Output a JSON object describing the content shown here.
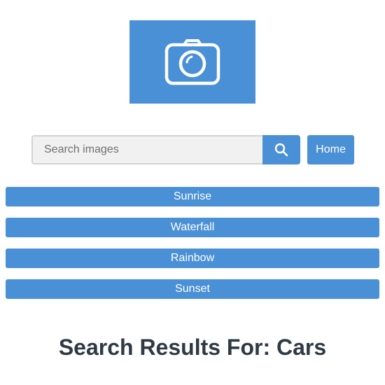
{
  "logo": {
    "icon": "camera-icon",
    "background": "#4a90d6"
  },
  "search": {
    "placeholder": "Search images",
    "value": "",
    "button_icon": "search-icon"
  },
  "nav": {
    "home_label": "Home"
  },
  "suggestions": [
    {
      "label": "Sunrise"
    },
    {
      "label": "Waterfall"
    },
    {
      "label": "Rainbow"
    },
    {
      "label": "Sunset"
    }
  ],
  "results": {
    "title": "Search Results For: Cars"
  },
  "colors": {
    "accent": "#4a90d6",
    "heading": "#2f3a45",
    "input_bg": "#f1f1f1"
  }
}
